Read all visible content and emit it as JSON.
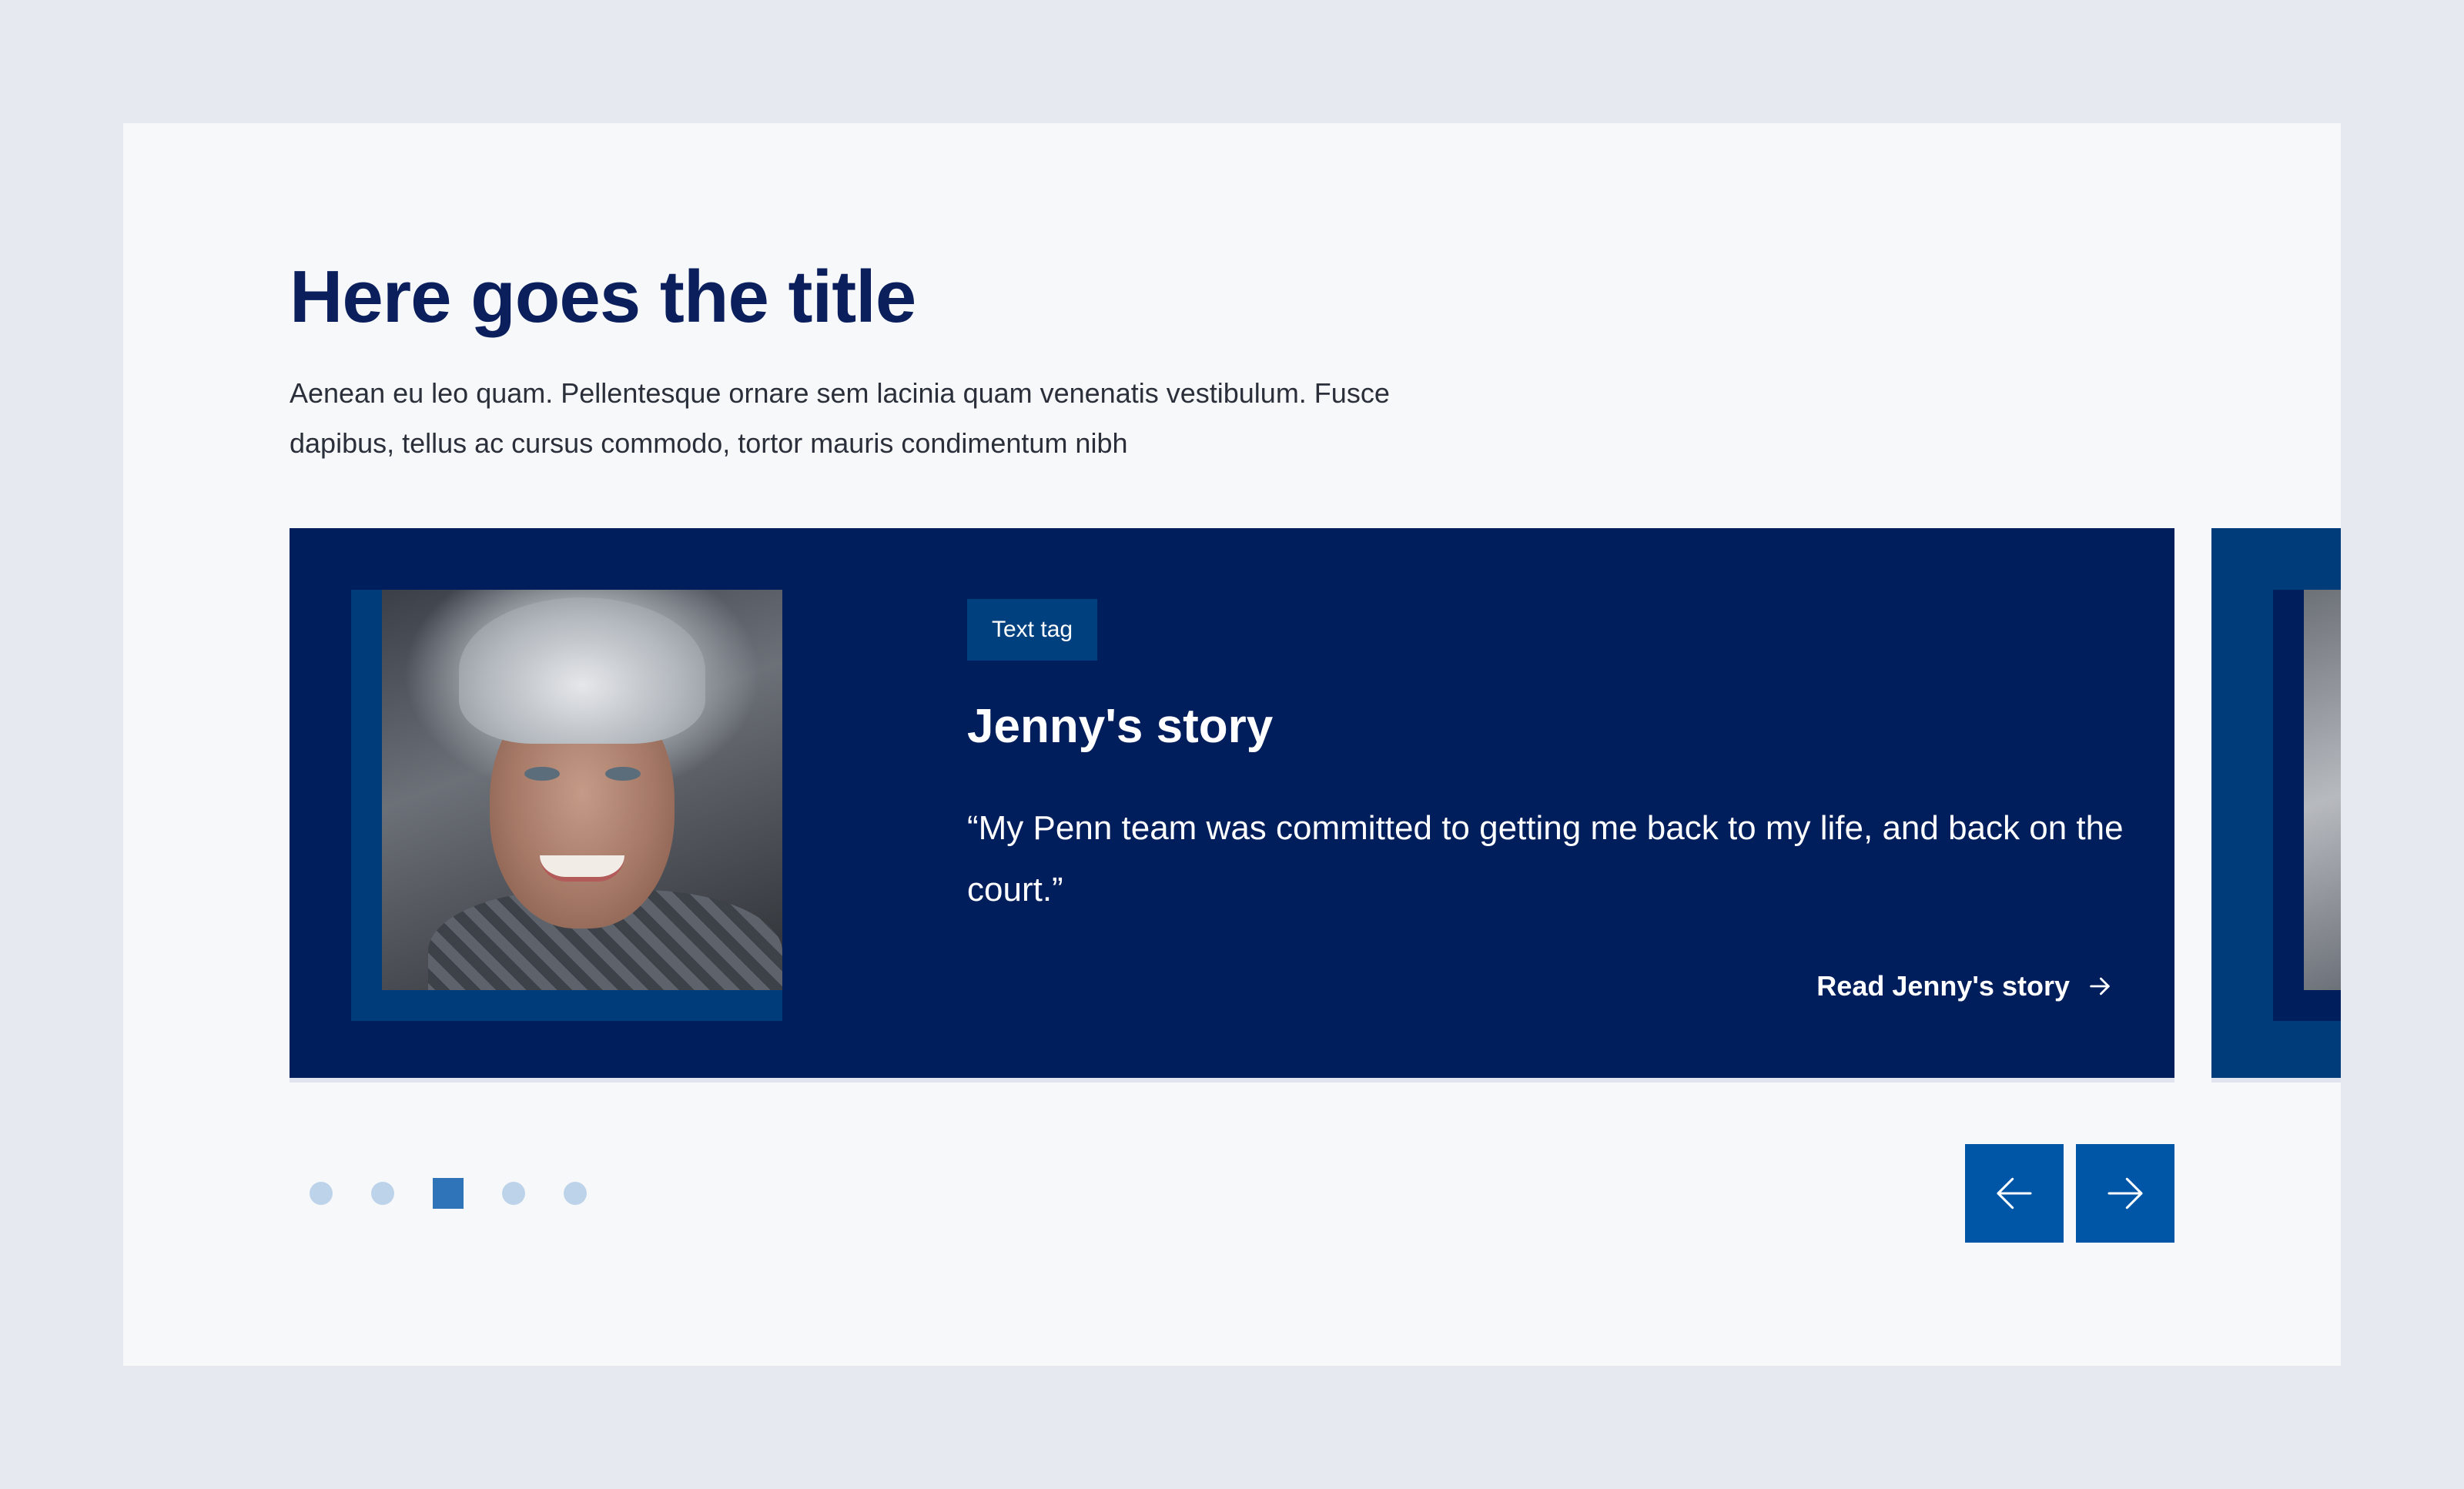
{
  "section": {
    "title": "Here goes the title",
    "description": "Aenean eu leo quam. Pellentesque ornare sem lacinia quam venenatis vestibulum. Fusce dapibus, tellus ac cursus commodo, tortor mauris condimentum nibh"
  },
  "carousel": {
    "active_slide": {
      "tag": "Text tag",
      "title": "Jenny's story",
      "quote": "“My Penn team was committed to getting me back to my life, and back on the court.”",
      "link_label": "Read Jenny's story",
      "link_icon": "arrow-right-icon",
      "image": "portrait-photo"
    },
    "pagination": {
      "total": 5,
      "active_index": 2
    },
    "controls": {
      "prev_icon": "arrow-left-icon",
      "next_icon": "arrow-right-icon"
    }
  },
  "colors": {
    "page_background": "#e6e9f0",
    "panel_background": "#f7f8fa",
    "title": "#0a1f5c",
    "card_background": "#001e5c",
    "accent_blue": "#003b7a",
    "tag_background": "#00407f",
    "nav_button": "#0056a6",
    "dot_inactive": "#bcd3ea",
    "dot_active": "#2f74b8"
  }
}
